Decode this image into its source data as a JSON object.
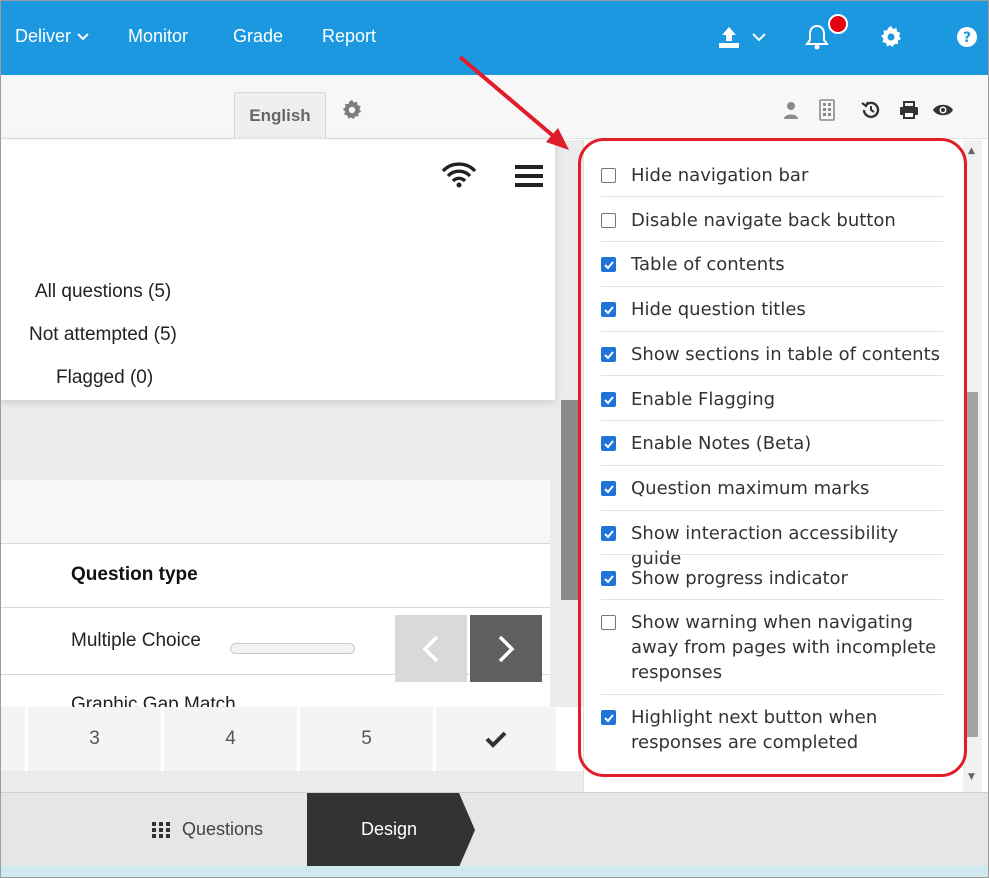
{
  "topbar": {
    "nav": [
      "Deliver",
      "Monitor",
      "Grade",
      "Report"
    ],
    "colors": {
      "bar": "#1b98e0",
      "badge": "#e60012"
    }
  },
  "subbar": {
    "language": "English"
  },
  "preview": {
    "filters": [
      "All questions (5)",
      "Not attempted (5)",
      "Flagged (0)"
    ],
    "table": {
      "header": "Question type",
      "rows": [
        "Multiple Choice",
        "Graphic Gap Match"
      ]
    },
    "pager": [
      "3",
      "4",
      "5"
    ]
  },
  "options": [
    {
      "label": "Hide navigation bar",
      "checked": false
    },
    {
      "label": "Disable navigate back button",
      "checked": false
    },
    {
      "label": "Table of contents",
      "checked": true
    },
    {
      "label": "Hide question titles",
      "checked": true
    },
    {
      "label": "Show sections in table of contents",
      "checked": true
    },
    {
      "label": "Enable Flagging",
      "checked": true
    },
    {
      "label": "Enable Notes (Beta)",
      "checked": true
    },
    {
      "label": "Question maximum marks",
      "checked": true
    },
    {
      "label": "Show interaction accessibility guide",
      "checked": true
    },
    {
      "label": "Show progress indicator",
      "checked": true
    },
    {
      "label": "Show warning when navigating away from pages with incomplete responses",
      "checked": false
    },
    {
      "label": "Highlight next button when responses are completed",
      "checked": true
    }
  ],
  "bottom": {
    "questions_tab": "Questions",
    "design_tab": "Design"
  },
  "annotation": {
    "color": "#e11d2a"
  }
}
